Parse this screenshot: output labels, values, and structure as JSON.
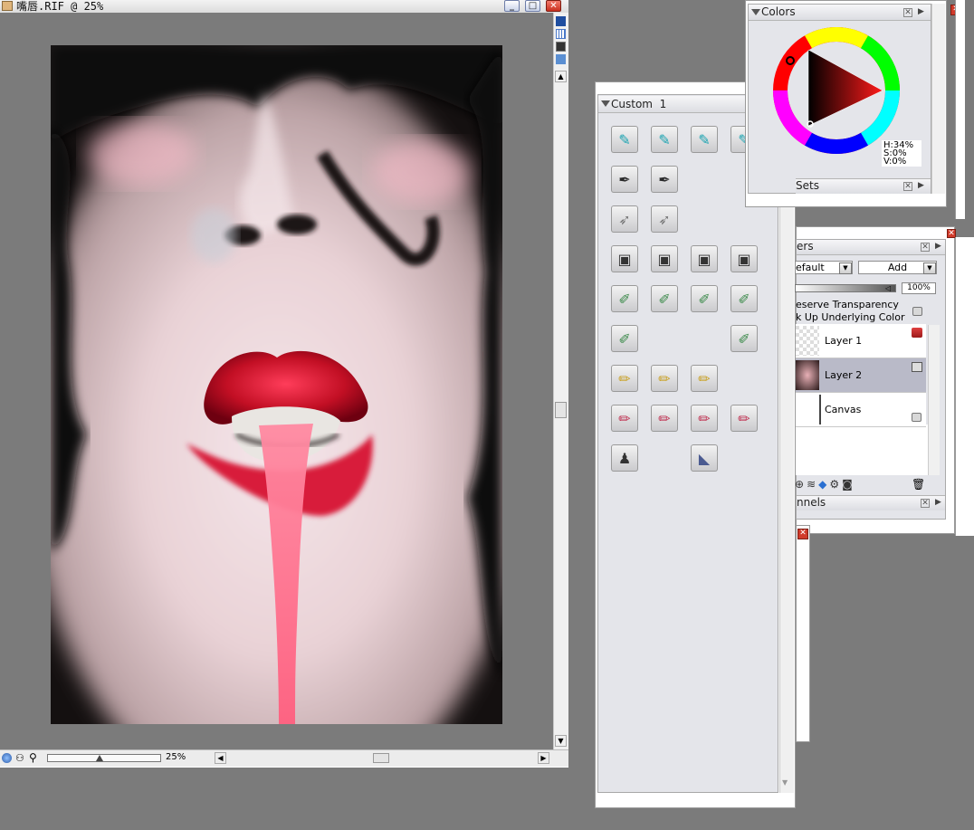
{
  "document": {
    "title": "嘴唇.RIF @ 25%",
    "zoom_label": "25%",
    "buttons": {
      "minimize": "_",
      "maximize": "□",
      "close": "✕"
    }
  },
  "brush_palette": {
    "title": "Custom  1",
    "rows": [
      [
        "pencil-icon",
        "pencil-icon",
        "pencil-icon",
        "pencil-icon"
      ],
      [
        "pen-nib-icon",
        "pen-nib-icon"
      ],
      [
        "airbrush-icon",
        "airbrush-icon"
      ],
      [
        "camera-icon",
        "camera-icon",
        "camera-icon",
        "camera-icon"
      ],
      [
        "watercolor-icon",
        "watercolor-icon",
        "watercolor-icon",
        "watercolor-icon"
      ],
      [
        "watercolor-icon",
        "",
        "",
        "watercolor-icon"
      ],
      [
        "flat-brush-icon",
        "flat-brush-icon",
        "flat-brush-icon"
      ],
      [
        "marker-icon",
        "marker-icon",
        "marker-icon",
        "marker-icon"
      ],
      [
        "ink-bottle-icon",
        "",
        "palette-knife-icon"
      ]
    ]
  },
  "colors_panel": {
    "title": "Colors",
    "hsv": {
      "h": "H:34%",
      "s": "S:0%",
      "v": "V:0%"
    },
    "sets_label": "Sets"
  },
  "layers_panel": {
    "title": "ers",
    "composite_method": "efault",
    "composite_depth": "Add",
    "opacity": "100%",
    "preserve_transparency": "eserve Transparency",
    "pick_up_underlying": "k Up Underlying Color",
    "layers": [
      {
        "name": "Layer 1",
        "selected": false
      },
      {
        "name": "Layer 2",
        "selected": true
      },
      {
        "name": "Canvas",
        "selected": false
      }
    ],
    "channels_label": "nnels"
  },
  "colors": {
    "accent_red": "#c8102e",
    "selection": "#b9bac8"
  }
}
